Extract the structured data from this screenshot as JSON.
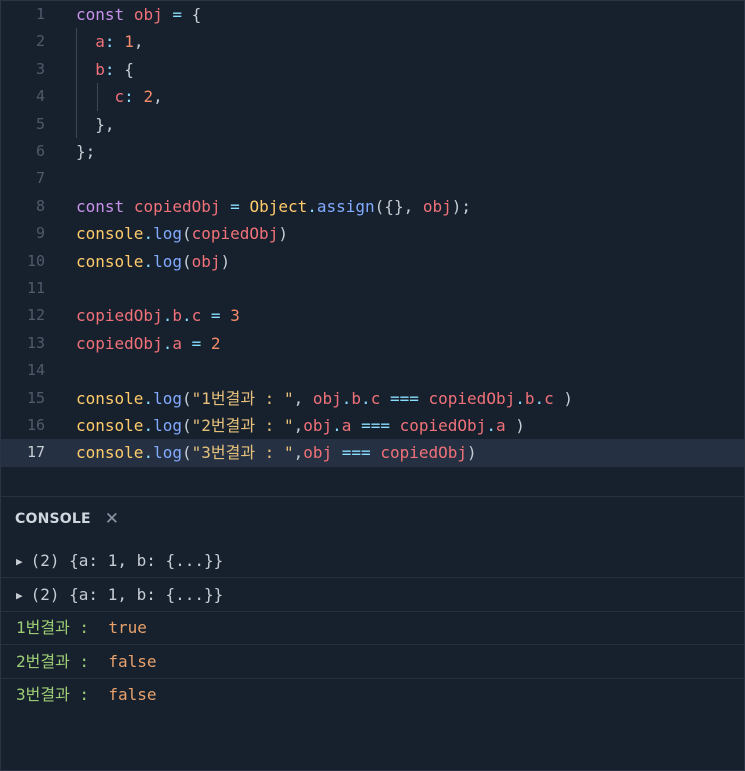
{
  "colors": {
    "keyword": "#c792ea",
    "variable": "#f07178",
    "number": "#f78c6c",
    "string": "#e6c07b",
    "function": "#82aaff",
    "builtin": "#ffcb6b",
    "punct": "#89ddff",
    "text": "#c6ccd4"
  },
  "editor": {
    "lines": [
      {
        "num": "1",
        "tokens": [
          [
            "const",
            "kw"
          ],
          [
            " ",
            "t"
          ],
          [
            "obj",
            "v"
          ],
          [
            " ",
            "t"
          ],
          [
            "=",
            "p"
          ],
          [
            " ",
            "t"
          ],
          [
            "{",
            "t"
          ]
        ]
      },
      {
        "num": "2",
        "tokens": [
          [
            "  ",
            "t"
          ],
          [
            "a",
            "v"
          ],
          [
            ":",
            "p"
          ],
          [
            " ",
            "t"
          ],
          [
            "1",
            "n"
          ],
          [
            ",",
            "t"
          ]
        ]
      },
      {
        "num": "3",
        "tokens": [
          [
            "  ",
            "t"
          ],
          [
            "b",
            "v"
          ],
          [
            ":",
            "p"
          ],
          [
            " ",
            "t"
          ],
          [
            "{",
            "t"
          ]
        ]
      },
      {
        "num": "4",
        "tokens": [
          [
            "    ",
            "t"
          ],
          [
            "c",
            "v"
          ],
          [
            ":",
            "p"
          ],
          [
            " ",
            "t"
          ],
          [
            "2",
            "n"
          ],
          [
            ",",
            "t"
          ]
        ]
      },
      {
        "num": "5",
        "tokens": [
          [
            "  ",
            "t"
          ],
          [
            "},",
            "t"
          ]
        ]
      },
      {
        "num": "6",
        "tokens": [
          [
            "};",
            "t"
          ]
        ]
      },
      {
        "num": "7",
        "tokens": []
      },
      {
        "num": "8",
        "tokens": [
          [
            "const",
            "kw"
          ],
          [
            " ",
            "t"
          ],
          [
            "copiedObj",
            "v"
          ],
          [
            " ",
            "t"
          ],
          [
            "=",
            "p"
          ],
          [
            " ",
            "t"
          ],
          [
            "Object",
            "b"
          ],
          [
            ".",
            "p"
          ],
          [
            "assign",
            "f"
          ],
          [
            "({}, ",
            "t"
          ],
          [
            "obj",
            "v"
          ],
          [
            ");",
            "t"
          ]
        ]
      },
      {
        "num": "9",
        "tokens": [
          [
            "console",
            "b"
          ],
          [
            ".",
            "p"
          ],
          [
            "log",
            "f"
          ],
          [
            "(",
            "t"
          ],
          [
            "copiedObj",
            "v"
          ],
          [
            ")",
            "t"
          ]
        ]
      },
      {
        "num": "10",
        "tokens": [
          [
            "console",
            "b"
          ],
          [
            ".",
            "p"
          ],
          [
            "log",
            "f"
          ],
          [
            "(",
            "t"
          ],
          [
            "obj",
            "v"
          ],
          [
            ")",
            "t"
          ]
        ]
      },
      {
        "num": "11",
        "tokens": []
      },
      {
        "num": "12",
        "tokens": [
          [
            "copiedObj",
            "v"
          ],
          [
            ".",
            "p"
          ],
          [
            "b",
            "v"
          ],
          [
            ".",
            "p"
          ],
          [
            "c",
            "v"
          ],
          [
            " ",
            "t"
          ],
          [
            "=",
            "p"
          ],
          [
            " ",
            "t"
          ],
          [
            "3",
            "n"
          ]
        ]
      },
      {
        "num": "13",
        "tokens": [
          [
            "copiedObj",
            "v"
          ],
          [
            ".",
            "p"
          ],
          [
            "a",
            "v"
          ],
          [
            " ",
            "t"
          ],
          [
            "=",
            "p"
          ],
          [
            " ",
            "t"
          ],
          [
            "2",
            "n"
          ]
        ]
      },
      {
        "num": "14",
        "tokens": []
      },
      {
        "num": "15",
        "tokens": [
          [
            "console",
            "b"
          ],
          [
            ".",
            "p"
          ],
          [
            "log",
            "f"
          ],
          [
            "(",
            "t"
          ],
          [
            "\"1번결과 : \"",
            "s"
          ],
          [
            ", ",
            "t"
          ],
          [
            "obj",
            "v"
          ],
          [
            ".",
            "p"
          ],
          [
            "b",
            "v"
          ],
          [
            ".",
            "p"
          ],
          [
            "c",
            "v"
          ],
          [
            " ",
            "t"
          ],
          [
            "===",
            "p"
          ],
          [
            " ",
            "t"
          ],
          [
            "copiedObj",
            "v"
          ],
          [
            ".",
            "p"
          ],
          [
            "b",
            "v"
          ],
          [
            ".",
            "p"
          ],
          [
            "c",
            "v"
          ],
          [
            " )",
            "t"
          ]
        ]
      },
      {
        "num": "16",
        "tokens": [
          [
            "console",
            "b"
          ],
          [
            ".",
            "p"
          ],
          [
            "log",
            "f"
          ],
          [
            "(",
            "t"
          ],
          [
            "\"2번결과 : \"",
            "s"
          ],
          [
            ",",
            "t"
          ],
          [
            "obj",
            "v"
          ],
          [
            ".",
            "p"
          ],
          [
            "a",
            "v"
          ],
          [
            " ",
            "t"
          ],
          [
            "===",
            "p"
          ],
          [
            " ",
            "t"
          ],
          [
            "copiedObj",
            "v"
          ],
          [
            ".",
            "p"
          ],
          [
            "a",
            "v"
          ],
          [
            " )",
            "t"
          ]
        ]
      },
      {
        "num": "17",
        "tokens": [
          [
            "console",
            "b"
          ],
          [
            ".",
            "p"
          ],
          [
            "log",
            "f"
          ],
          [
            "(",
            "t"
          ],
          [
            "\"3번결과 : \"",
            "s"
          ],
          [
            ",",
            "t"
          ],
          [
            "obj",
            "v"
          ],
          [
            " ",
            "t"
          ],
          [
            "===",
            "p"
          ],
          [
            " ",
            "t"
          ],
          [
            "copiedObj",
            "v"
          ],
          [
            ")",
            "t"
          ]
        ]
      }
    ]
  },
  "console": {
    "title": "CONSOLE",
    "close_icon": "close-icon",
    "expander_icon": "triangle-right-icon",
    "entries": [
      {
        "type": "object",
        "text": "(2) {a: 1, b: {...}}"
      },
      {
        "type": "object",
        "text": "(2) {a: 1, b: {...}}"
      },
      {
        "type": "log",
        "label": "1번결과 :",
        "value": "true"
      },
      {
        "type": "log",
        "label": "2번결과 :",
        "value": "false"
      },
      {
        "type": "log",
        "label": "3번결과 :",
        "value": "false"
      }
    ]
  }
}
